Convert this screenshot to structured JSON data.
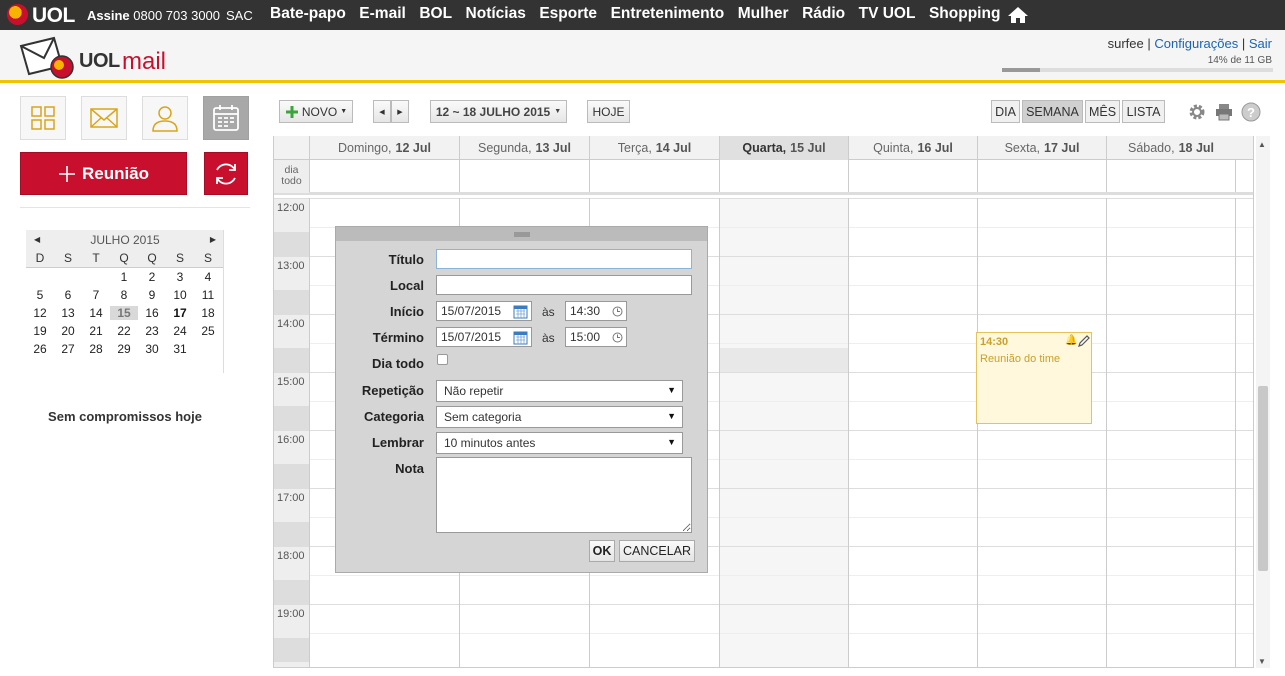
{
  "topbar": {
    "brand": "UOL",
    "assine_label": "Assine",
    "phone": "0800 703 3000",
    "sac": "SAC",
    "nav": [
      "Bate-papo",
      "E-mail",
      "BOL",
      "Notícias",
      "Esporte",
      "Entretenimento",
      "Mulher",
      "Rádio",
      "TV UOL",
      "Shopping"
    ]
  },
  "header": {
    "logo_uol": "UOL",
    "logo_mail": "mail",
    "username": "surfee",
    "settings_link": "Configurações",
    "logout_link": "Sair",
    "separator": "|",
    "quota_text": "14% de 11 GB",
    "quota_fraction": 0.14
  },
  "sidebar": {
    "new_meeting": "Reunião",
    "mini_calendar": {
      "month_label": "JULHO 2015",
      "weekdays": [
        "D",
        "S",
        "T",
        "Q",
        "Q",
        "S",
        "S"
      ],
      "days": [
        "",
        "",
        "",
        "1",
        "2",
        "3",
        "4",
        "5",
        "6",
        "7",
        "8",
        "9",
        "10",
        "11",
        "12",
        "13",
        "14",
        "15",
        "16",
        "17",
        "18",
        "19",
        "20",
        "21",
        "22",
        "23",
        "24",
        "25",
        "26",
        "27",
        "28",
        "29",
        "30",
        "31"
      ],
      "today": "15",
      "selected": "17"
    },
    "no_events": "Sem compromissos hoje"
  },
  "toolbar": {
    "new_label": "NOVO",
    "range_label": "12 ~ 18 JULHO 2015",
    "today_label": "HOJE",
    "views": [
      "DIA",
      "SEMANA",
      "MÊS",
      "LISTA"
    ],
    "active_view": "SEMANA"
  },
  "calendar": {
    "allday_label": "dia todo",
    "days": [
      {
        "name": "Domingo,",
        "date": "12 Jul"
      },
      {
        "name": "Segunda,",
        "date": "13 Jul"
      },
      {
        "name": "Terça,",
        "date": "14 Jul"
      },
      {
        "name": "Quarta,",
        "date": "15 Jul"
      },
      {
        "name": "Quinta,",
        "date": "16 Jul"
      },
      {
        "name": "Sexta,",
        "date": "17 Jul"
      },
      {
        "name": "Sábado,",
        "date": "18 Jul"
      }
    ],
    "hours": [
      "12:00",
      "13:00",
      "14:00",
      "15:00",
      "16:00",
      "17:00",
      "18:00",
      "19:00"
    ],
    "event": {
      "time": "14:30",
      "title": "Reunião do time"
    }
  },
  "dialog": {
    "title_label": "Título",
    "title_value": "",
    "location_label": "Local",
    "location_value": "",
    "start_label": "Início",
    "start_date": "15/07/2015",
    "start_time": "14:30",
    "end_label": "Término",
    "end_date": "15/07/2015",
    "end_time": "15:00",
    "at_label": "às",
    "allday_label": "Dia todo",
    "repeat_label": "Repetição",
    "repeat_value": "Não repetir",
    "category_label": "Categoria",
    "category_value": "Sem categoria",
    "remind_label": "Lembrar",
    "remind_value": "10 minutos antes",
    "note_label": "Nota",
    "ok_label": "OK",
    "cancel_label": "CANCELAR"
  }
}
